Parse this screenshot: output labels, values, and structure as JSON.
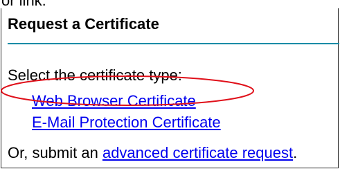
{
  "top_cut_text": "or link:",
  "panel": {
    "title": "Request a Certificate",
    "select_label": "Select the certificate type:",
    "cert_types": [
      {
        "label": "Web Browser Certificate"
      },
      {
        "label": "E-Mail Protection Certificate"
      }
    ],
    "footer_prefix": "Or, submit an ",
    "advanced_link": "advanced certificate request",
    "footer_suffix": "."
  },
  "colors": {
    "title_rule": "#1a8ca6",
    "link": "#0000ee",
    "highlight_ellipse": "#e0101a"
  }
}
